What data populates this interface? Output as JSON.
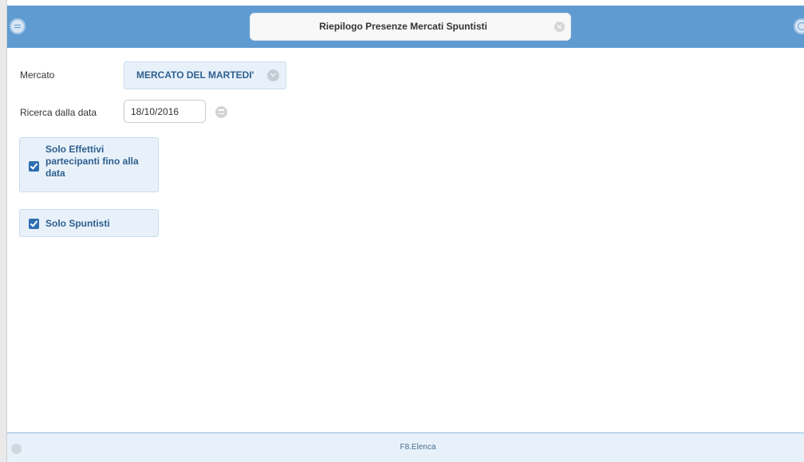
{
  "header": {
    "title": "Riepilogo Presenze Mercati Spuntisti",
    "menu_icon": "menu-icon",
    "close_icon": "close-icon",
    "power_icon": "power-icon",
    "accent_color": "#5f9bd1"
  },
  "form": {
    "mercato": {
      "label": "Mercato",
      "value": "MERCATO DEL MARTEDI'",
      "icon": "chevron-down-icon"
    },
    "data": {
      "label": "Ricerca dalla data",
      "value": "18/10/2016",
      "icon": "calendar-icon"
    },
    "checkboxes": [
      {
        "label_lines": [
          "Solo Effettivi",
          "partecipanti fino alla",
          "data"
        ],
        "checked": true
      },
      {
        "label_lines": [
          "Solo Spuntisti"
        ],
        "checked": true
      }
    ]
  },
  "footer": {
    "action_label": "F8.Elenca",
    "status_icon": "status-dot-icon"
  }
}
